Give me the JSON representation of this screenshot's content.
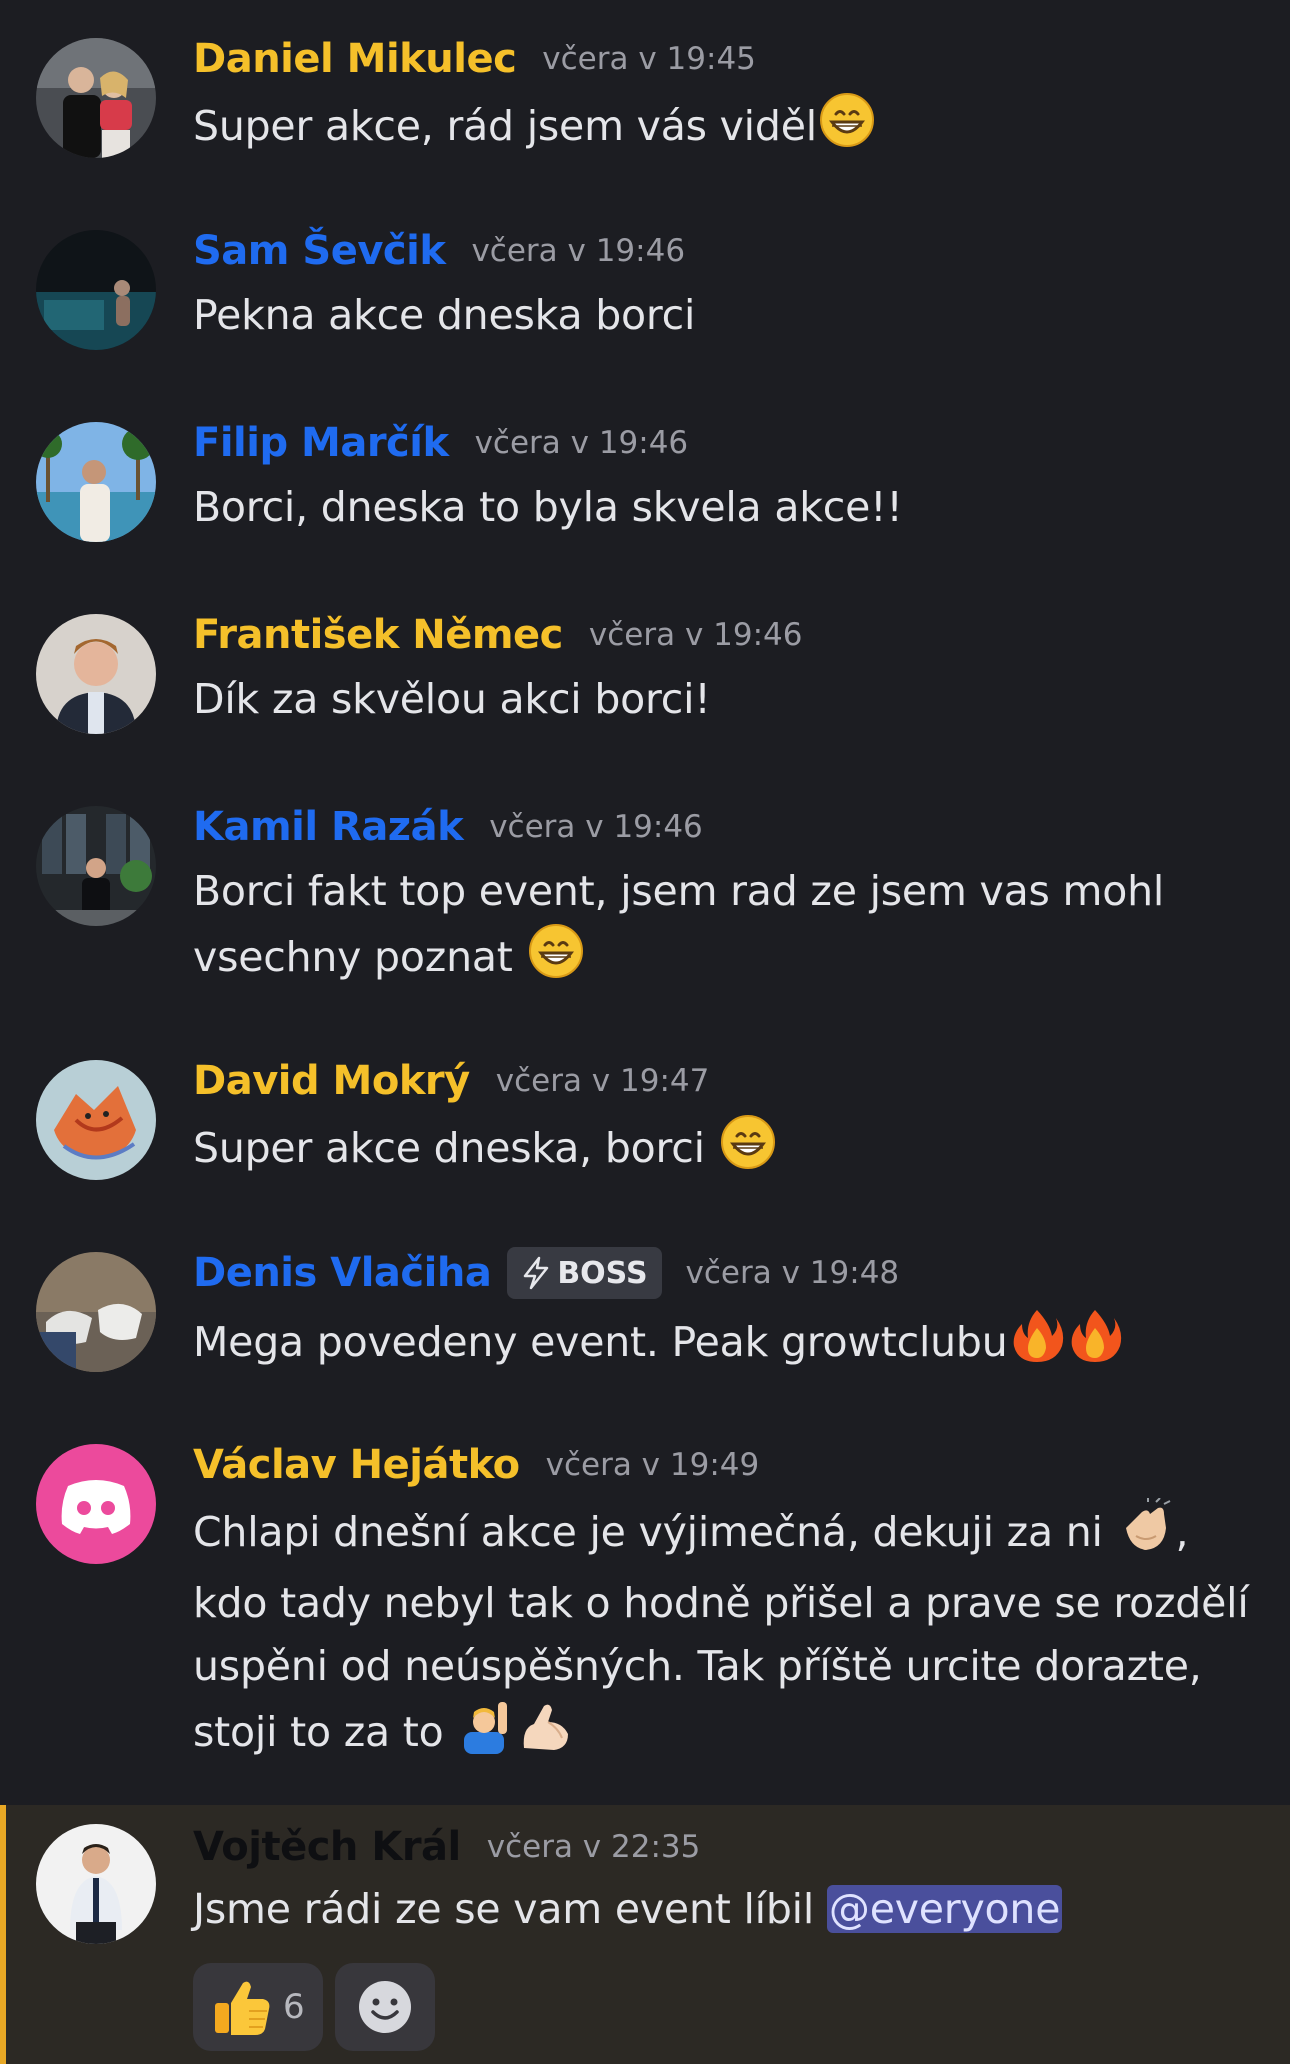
{
  "messages": [
    {
      "name": "Daniel Mikulec",
      "time": "včera v 19:45",
      "text": "Super akce, rád jsem vás viděl"
    },
    {
      "name": "Sam Ševčik",
      "time": "včera v 19:46",
      "text": "Pekna akce dneska borci"
    },
    {
      "name": "Filip Marčík",
      "time": "včera v 19:46",
      "text": "Borci, dneska to byla skvela akce!!"
    },
    {
      "name": "František Němec",
      "time": "včera v 19:46",
      "text": "Dík za skvělou akci borci!"
    },
    {
      "name": "Kamil Razák",
      "time": "včera v 19:46",
      "text_line1": "Borci fakt top event, jsem rad ze jsem vas mohl",
      "text_line2": "vsechny poznat"
    },
    {
      "name": "David Mokrý",
      "time": "včera v 19:47",
      "text": "Super akce dneska, borci"
    },
    {
      "name": "Denis Vlačiha",
      "tag": "BOSS",
      "time": "včera v 19:48",
      "text": "Mega povedeny event. Peak growtclubu"
    },
    {
      "name": "Václav Hejátko",
      "time": "včera v 19:49",
      "text_part1": "Chlapi dnešní akce je výjimečná, dekuji za ni",
      "text_part2": ", kdo tady nebyl tak o hodně přišel a prave se rozdělí uspěni od neúspěšných. Tak příště urcite dorazte, stoji to za to"
    },
    {
      "name": "Vojtěch Král",
      "time": "včera v 22:35",
      "text": "Jsme rádi ze se vam event líbil",
      "mention": "@everyone"
    }
  ],
  "reactions": [
    {
      "emoji": "thumbs-up",
      "count": "6"
    },
    {
      "emoji": "add-reaction"
    }
  ],
  "colors": {
    "background": "#1c1d22",
    "name_yellow": "#f5c02a",
    "name_blue": "#1f6bf0",
    "highlight_bg": "#2c2924",
    "highlight_bar": "#e8a825",
    "mention_bg": "#4a4f9c"
  }
}
